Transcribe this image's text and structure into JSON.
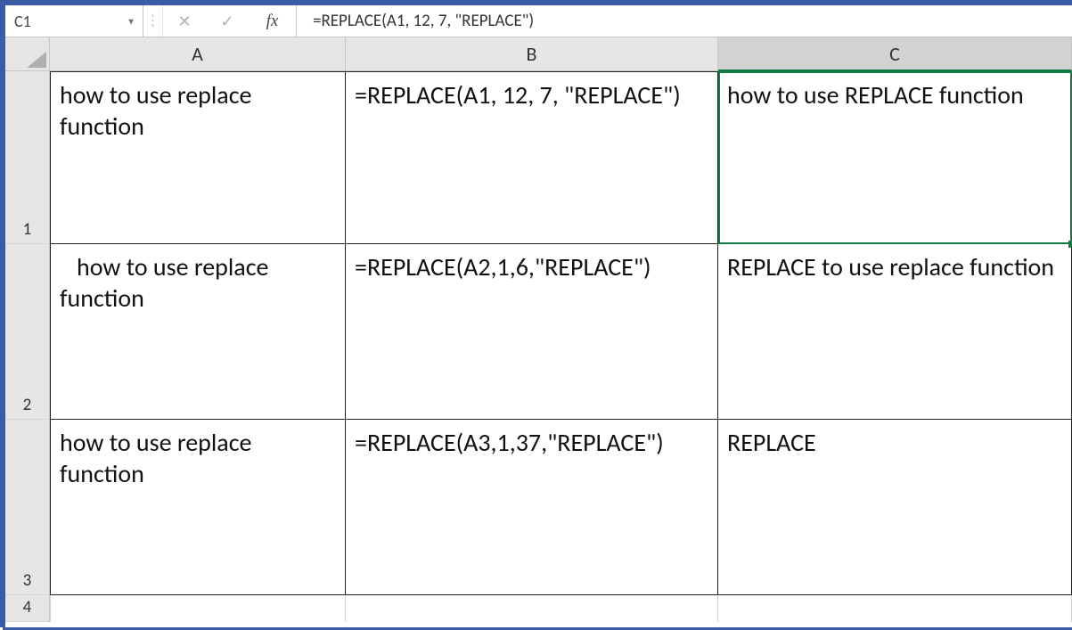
{
  "formula_bar": {
    "name_box": "C1",
    "cancel_label": "✕",
    "enter_label": "✓",
    "fx_label": "fx",
    "formula": "=REPLACE(A1, 12, 7, \"REPLACE\")"
  },
  "columns": [
    "A",
    "B",
    "C"
  ],
  "row_numbers": [
    "1",
    "2",
    "3",
    "4"
  ],
  "selected_cell": "C1",
  "cells": {
    "A1": "how to use replace function",
    "B1": "=REPLACE(A1, 12, 7, \"REPLACE\")",
    "C1": "how to use REPLACE function",
    "A2": "   how to use replace function",
    "B2": "=REPLACE(A2,1,6,\"REPLACE\")",
    "C2": "REPLACE to use replace function",
    "A3": "how to use replace function",
    "B3": "=REPLACE(A3,1,37,\"REPLACE\")",
    "C3": "REPLACE"
  }
}
